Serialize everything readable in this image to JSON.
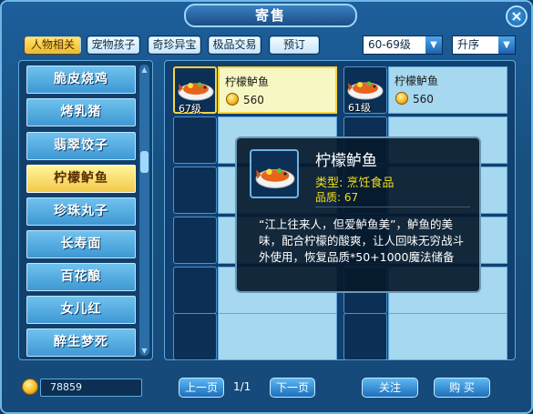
{
  "window": {
    "title": "寄售",
    "close_glyph": "×"
  },
  "tabs": [
    {
      "label": "人物相关",
      "active": true
    },
    {
      "label": "宠物孩子",
      "active": false
    },
    {
      "label": "奇珍异宝",
      "active": false
    },
    {
      "label": "极品交易",
      "active": false
    },
    {
      "label": "预订",
      "active": false
    }
  ],
  "filters": {
    "level": {
      "value": "60-69级"
    },
    "sort": {
      "value": "升序"
    }
  },
  "food_list": {
    "items": [
      "脆皮烧鸡",
      "烤乳猪",
      "翡翠饺子",
      "柠檬鲈鱼",
      "珍珠丸子",
      "长寿面",
      "百花酿",
      "女儿红",
      "醉生梦死"
    ],
    "selected_index": 3
  },
  "listings": [
    {
      "name": "柠檬鲈鱼",
      "level": "67级",
      "price": "560",
      "selected": true
    },
    {
      "name": "柠檬鲈鱼",
      "level": "61级",
      "price": "560",
      "selected": false
    }
  ],
  "tooltip": {
    "name": "柠檬鲈鱼",
    "type_label": "类型",
    "type_value": "烹饪食品",
    "quality_label": "品质",
    "quality_value": "67",
    "description": "“江上往来人，但爱鲈鱼美”，鲈鱼的美味，配合柠檬的酸爽，让人回味无穷战斗外使用，恢复品质*50+1000魔法储备"
  },
  "footer": {
    "gold": "78859",
    "prev_page": "上一页",
    "page_indicator": "1/1",
    "next_page": "下一页",
    "follow": "关注",
    "buy": "购  买"
  },
  "icons": {
    "coin": "coin-icon",
    "dish": "fish-dish-icon",
    "arrow": "chevron-down-icon"
  },
  "colors": {
    "selected_gold": "#f6d53c",
    "panel_blue": "#114070",
    "slot_blue": "#a6d8ef",
    "tooltip_yellow": "#f3df1d"
  }
}
